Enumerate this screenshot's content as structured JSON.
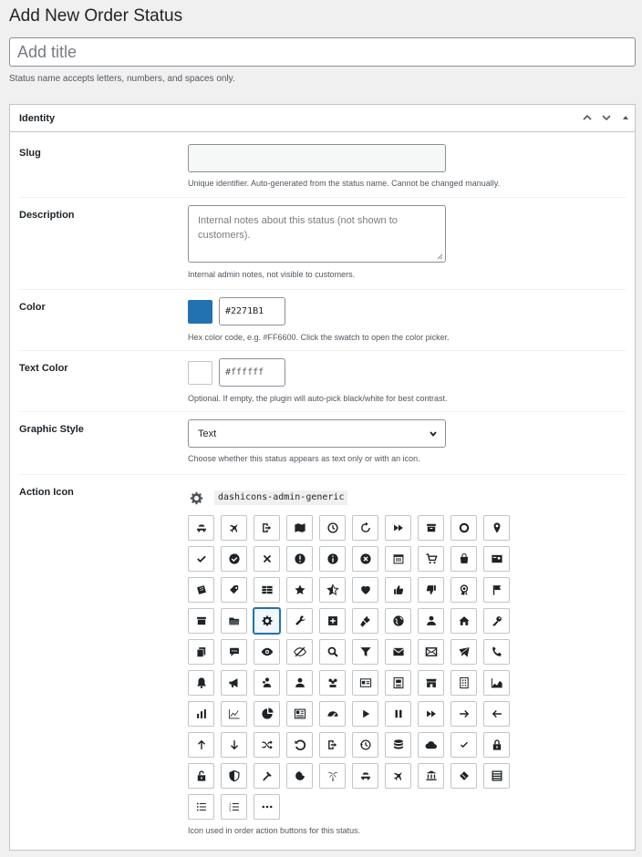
{
  "page": {
    "title": "Add New Order Status"
  },
  "title_field": {
    "placeholder": "Add title",
    "hint": "Status name accepts letters, numbers, and spaces only."
  },
  "identity_box": {
    "title": "Identity",
    "slug": {
      "label": "Slug",
      "value": "",
      "hint": "Unique identifier. Auto-generated from the status name. Cannot be changed manually."
    },
    "description": {
      "label": "Description",
      "placeholder": "Internal notes about this status (not shown to customers).",
      "hint": "Internal admin notes, not visible to customers."
    },
    "color": {
      "label": "Color",
      "swatch": "#2271b1",
      "value": "#2271B1",
      "hint": "Hex color code, e.g. #FF6600. Click the swatch to open the color picker."
    },
    "text_color": {
      "label": "Text Color",
      "swatch": "#ffffff",
      "value": "#ffffff",
      "hint": "Optional. If empty, the plugin will auto-pick black/white for best contrast."
    },
    "graphic_style": {
      "label": "Graphic Style",
      "selected": "Text",
      "hint": "Choose whether this status appears as text only or with an icon."
    },
    "action_icon": {
      "label": "Action Icon",
      "selected_icon": "dashicons-admin-generic",
      "selected_icon_name": "gear-icon",
      "hint": "Icon used in order action buttons for this status.",
      "icons": [
        "car-icon",
        "airplane-icon",
        "exit-icon",
        "map-icon",
        "clock-icon",
        "update-icon",
        "fast-forward-icon",
        "archive-icon",
        "circle-icon",
        "location-pin-icon",
        "checkmark-icon",
        "check-circle-icon",
        "close-icon",
        "warning-icon",
        "info-icon",
        "dismiss-circle-icon",
        "calendar-icon",
        "cart-icon",
        "store-bag-icon",
        "id-card-icon",
        "coupon-icon",
        "tag-icon",
        "list-table-icon",
        "star-filled-icon",
        "star-half-icon",
        "heart-icon",
        "thumbs-up-icon",
        "thumbs-down-icon",
        "award-icon",
        "flag-icon",
        "archive-box-icon",
        "folder-open-icon",
        "gear-icon",
        "wrench-icon",
        "plus-box-icon",
        "plugin-icon",
        "globe-icon",
        "user-icon",
        "home-icon",
        "key-icon",
        "copy-icon",
        "chat-bubble-icon",
        "eye-icon",
        "eye-hidden-icon",
        "search-icon",
        "filter-icon",
        "email-icon",
        "email-alt-icon",
        "email-send-icon",
        "phone-icon",
        "bell-icon",
        "megaphone-icon",
        "user-group-icon",
        "person-icon",
        "groups-icon",
        "id-icon",
        "address-card-icon",
        "store-icon",
        "building-icon",
        "area-chart-icon",
        "bar-chart-icon",
        "line-chart-icon",
        "pie-chart-icon",
        "newspaper-icon",
        "dashboard-icon",
        "play-icon",
        "pause-icon",
        "forward-icon",
        "arrow-right-icon",
        "arrow-left-icon",
        "arrow-up-icon",
        "arrow-down-icon",
        "shuffle-icon",
        "undo-icon",
        "logout-icon",
        "backup-icon",
        "database-icon",
        "cloud-icon",
        "check-small-icon",
        "lock-icon",
        "unlock-icon",
        "shield-icon",
        "hammer-icon",
        "food-icon",
        "palm-tree-icon",
        "car-alt-icon",
        "airplane-alt-icon",
        "bank-icon",
        "ticket-icon",
        "list-rows-icon",
        "list-unordered-icon",
        "list-ordered-icon",
        "ellipsis-icon"
      ]
    }
  }
}
